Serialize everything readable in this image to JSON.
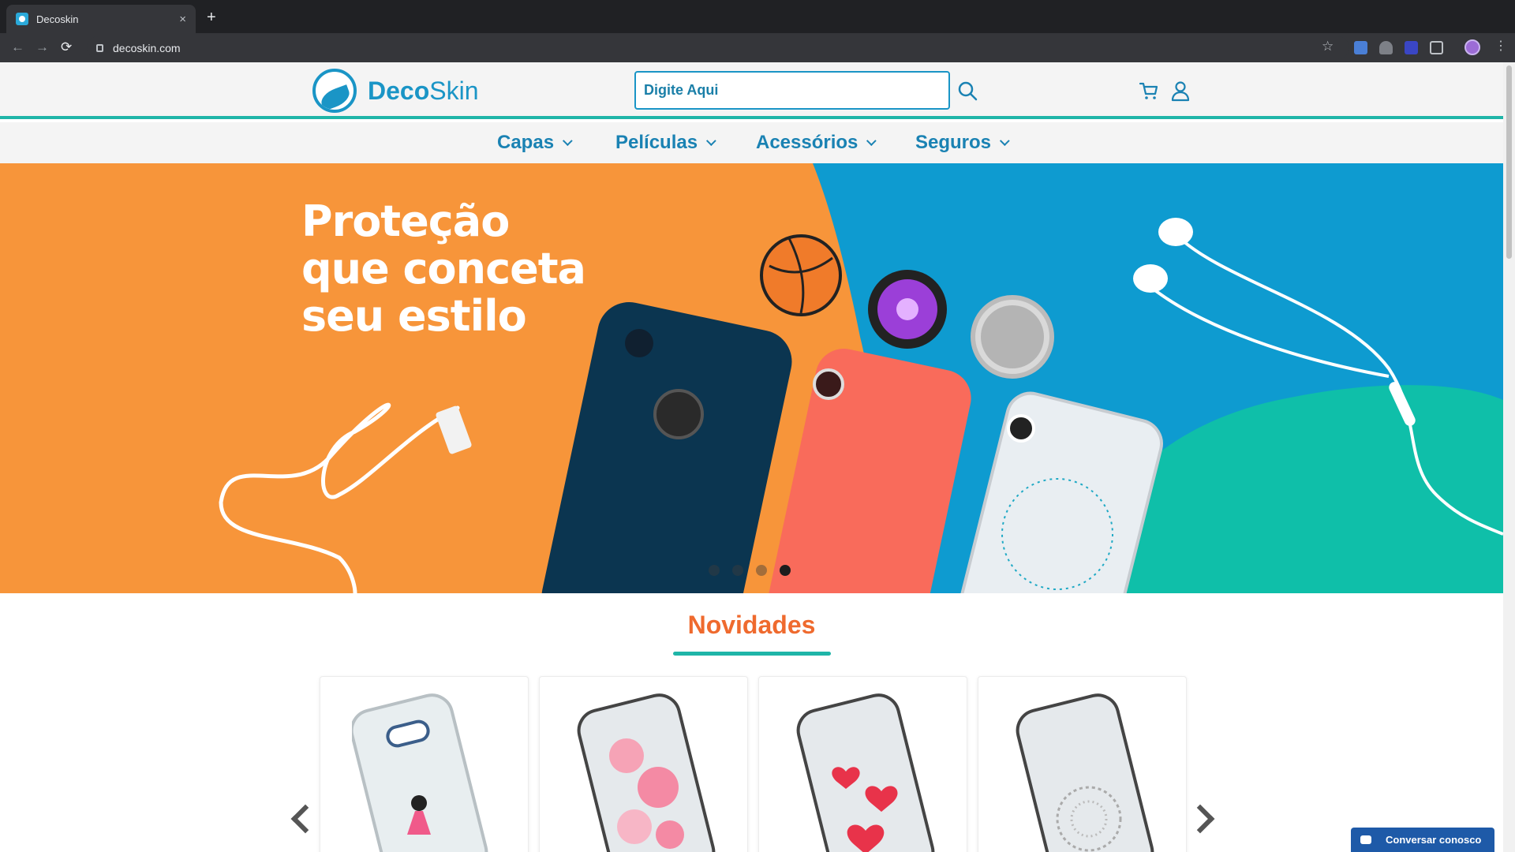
{
  "browser": {
    "tab_title": "Decoskin",
    "tab_close": "×",
    "new_tab": "+",
    "url": "decoskin.com",
    "back": "←",
    "forward": "→",
    "reload": "⟳",
    "bookmark": "☆",
    "menu": "⋮"
  },
  "header": {
    "logo_strong": "Deco",
    "logo_light": "Skin",
    "search_placeholder": "Digite Aqui",
    "icons": [
      "search-icon",
      "cart-icon",
      "user-icon"
    ]
  },
  "menu": {
    "items": [
      {
        "label": "Capas"
      },
      {
        "label": "Películas"
      },
      {
        "label": "Acessórios"
      },
      {
        "label": "Seguros"
      }
    ]
  },
  "hero": {
    "line1": "Proteção",
    "line2": "que conceta",
    "line3": "seu estilo",
    "slides": 4,
    "active_slide": 4,
    "colors": {
      "orange": "#f7953a",
      "blue": "#0e9bd0",
      "teal": "#0fbfa9"
    }
  },
  "novidades": {
    "title": "Novidades",
    "products": [
      {
        "icon": "phone-case-fairy-icon"
      },
      {
        "icon": "phone-case-pink-flowers-icon"
      },
      {
        "icon": "phone-case-hearts-icon"
      },
      {
        "icon": "phone-case-lace-icon"
      }
    ]
  },
  "chat": {
    "label": "Conversar conosco"
  }
}
